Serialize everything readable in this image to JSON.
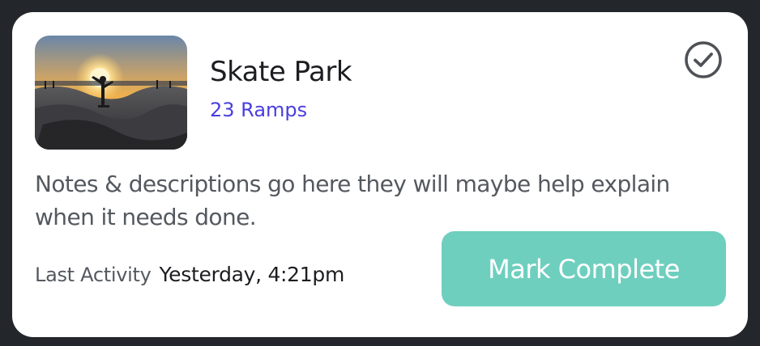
{
  "card": {
    "title": "Skate Park",
    "subtitle": "23 Ramps",
    "notes": "Notes & descriptions go here they will maybe help explain when it needs done.",
    "activity_label": "Last Activity",
    "activity_value": "Yesterday, 4:21pm",
    "mark_complete_label": "Mark Complete",
    "icons": {
      "status": "check-circle-icon"
    },
    "colors": {
      "accent_link": "#4a3ee0",
      "button": "#6fcfbf",
      "background": "#23272b"
    }
  }
}
